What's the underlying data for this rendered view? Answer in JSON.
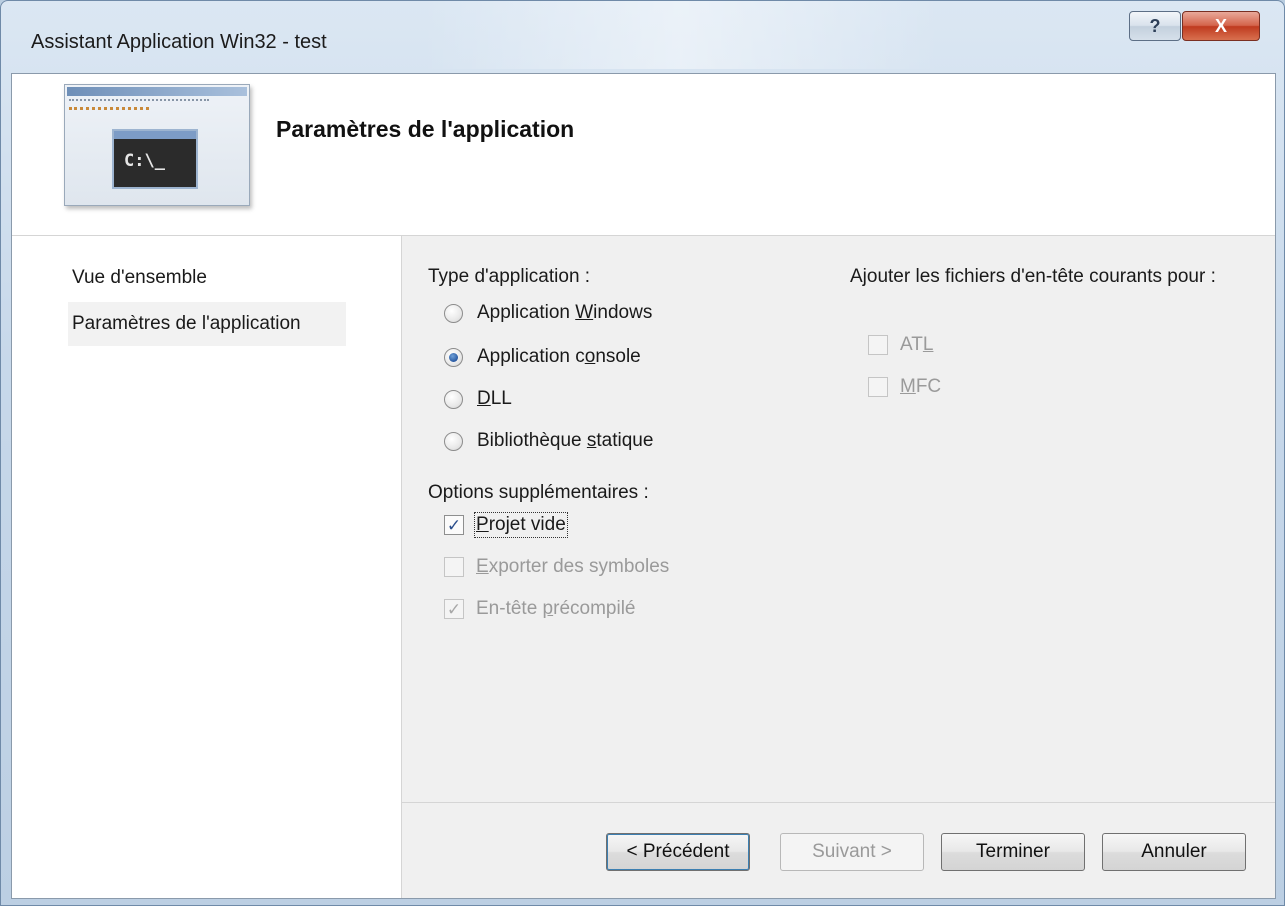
{
  "window": {
    "title": "Assistant Application Win32 - test",
    "help_label": "?",
    "close_label": "X"
  },
  "header": {
    "title": "Paramètres de l'application",
    "thumbnail_prompt": "C:\\_"
  },
  "nav": {
    "items": [
      {
        "label": "Vue d'ensemble",
        "selected": false
      },
      {
        "label": "Paramètres de l'application",
        "selected": true
      }
    ]
  },
  "app_type": {
    "label": "Type d'application :",
    "options": [
      {
        "pre": "Application ",
        "mnemonic": "W",
        "post": "indows",
        "checked": false
      },
      {
        "pre": "Application c",
        "mnemonic": "o",
        "post": "nsole",
        "checked": true
      },
      {
        "pre": "",
        "mnemonic": "D",
        "post": "LL",
        "checked": false
      },
      {
        "pre": "Bibliothèque ",
        "mnemonic": "s",
        "post": "tatique",
        "checked": false
      }
    ]
  },
  "extra_options": {
    "label": "Options supplémentaires :",
    "options": [
      {
        "pre": "",
        "mnemonic": "P",
        "post": "rojet vide",
        "checked": true,
        "enabled": true
      },
      {
        "pre": "",
        "mnemonic": "E",
        "post": "xporter des symboles",
        "checked": false,
        "enabled": false
      },
      {
        "pre": "En-tête ",
        "mnemonic": "p",
        "post": "récompilé",
        "checked": true,
        "enabled": false
      }
    ]
  },
  "headers": {
    "label": "Ajouter les fichiers d'en-tête courants pour :",
    "options": [
      {
        "pre": "AT",
        "mnemonic": "L",
        "post": "",
        "checked": false,
        "enabled": false
      },
      {
        "pre": "",
        "mnemonic": "M",
        "post": "FC",
        "checked": false,
        "enabled": false
      }
    ]
  },
  "buttons": {
    "previous": "< Précédent",
    "next": "Suivant >",
    "finish": "Terminer",
    "cancel": "Annuler"
  },
  "colors": {
    "titlebar": "#c7d8ea",
    "close_button": "#c9462a",
    "dialog_background": "#f0f0f0",
    "check_mark": "#2b4e8c"
  }
}
